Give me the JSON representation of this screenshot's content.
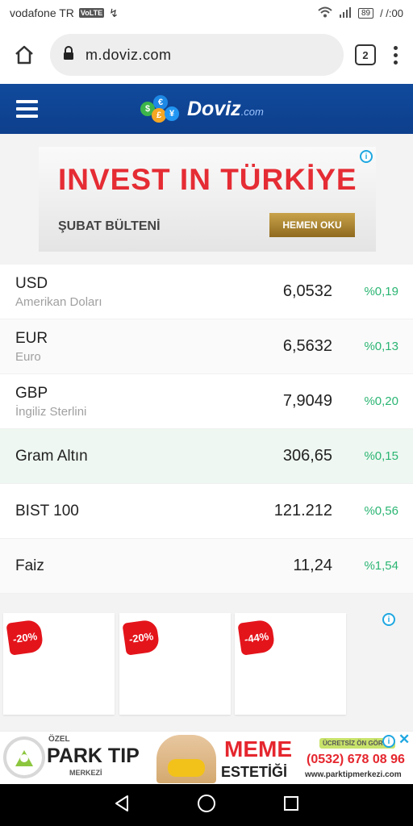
{
  "status_bar": {
    "carrier": "vodafone TR",
    "volte": "VoLTE",
    "battery": "89",
    "time": "/ /:00"
  },
  "browser": {
    "url": "m.doviz.com",
    "tab_count": "2"
  },
  "site": {
    "logo_text": "Doviz",
    "logo_suffix": ".com"
  },
  "ad_banner": {
    "title": "INVEST IN TÜRKİYE",
    "subtitle": "ŞUBAT BÜLTENİ",
    "button": "HEMEN OKU"
  },
  "rates": [
    {
      "code": "USD",
      "name": "Amerikan Doları",
      "value": "6,0532",
      "change": "%0,19"
    },
    {
      "code": "EUR",
      "name": "Euro",
      "value": "6,5632",
      "change": "%0,13"
    },
    {
      "code": "GBP",
      "name": "İngiliz Sterlini",
      "value": "7,9049",
      "change": "%0,20"
    },
    {
      "code": "Gram Altın",
      "name": "",
      "value": "306,65",
      "change": "%0,15"
    },
    {
      "code": "BIST 100",
      "name": "",
      "value": "121.212",
      "change": "%0,56"
    },
    {
      "code": "Faiz",
      "name": "",
      "value": "11,24",
      "change": "%1,54"
    }
  ],
  "promos": [
    {
      "discount": "-20%"
    },
    {
      "discount": "-20%"
    },
    {
      "discount": "-44%"
    }
  ],
  "bottom_ad": {
    "brand_prefix": "ÖZEL",
    "brand": "PARK TIP",
    "brand_suffix": "MERKEZİ",
    "headline1": "MEME",
    "headline2": "ESTETİĞİ",
    "badge": "ÜCRETSİZ ÖN GÖRÜŞ",
    "phone": "(0532) 678 08 96",
    "web": "www.parktipmerkezi.com"
  },
  "colors": {
    "header_blue": "#114a9c",
    "change_green": "#2bb573",
    "ad_red": "#e52c34"
  }
}
